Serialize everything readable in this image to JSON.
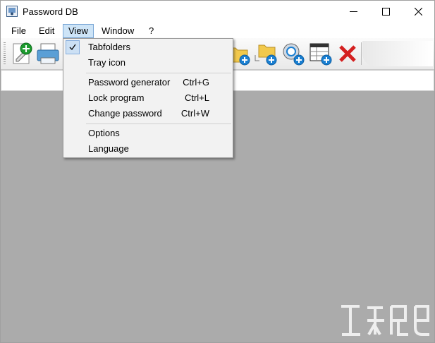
{
  "window": {
    "title": "Password DB"
  },
  "menubar": {
    "items": [
      {
        "label": "File"
      },
      {
        "label": "Edit"
      },
      {
        "label": "View"
      },
      {
        "label": "Window"
      },
      {
        "label": "?"
      }
    ]
  },
  "view_menu": {
    "items": [
      {
        "label": "Tabfolders",
        "checked": true,
        "shortcut": ""
      },
      {
        "label": "Tray icon",
        "checked": false,
        "shortcut": ""
      },
      {
        "label": "Password generator",
        "shortcut": "Ctrl+G"
      },
      {
        "label": "Lock program",
        "shortcut": "Ctrl+L"
      },
      {
        "label": "Change password",
        "shortcut": "Ctrl+W"
      },
      {
        "label": "Options",
        "shortcut": ""
      },
      {
        "label": "Language",
        "shortcut": ""
      }
    ]
  },
  "toolbar": {
    "icons": [
      "new-entry-icon",
      "print-icon",
      "add-folder-icon",
      "add-subfolder-icon",
      "add-search-icon",
      "add-table-icon",
      "delete-icon"
    ]
  },
  "colors": {
    "client_bg": "#ababab",
    "accent": "#0078d7",
    "delete_red": "#d42020",
    "add_green": "#1d9b2f"
  }
}
